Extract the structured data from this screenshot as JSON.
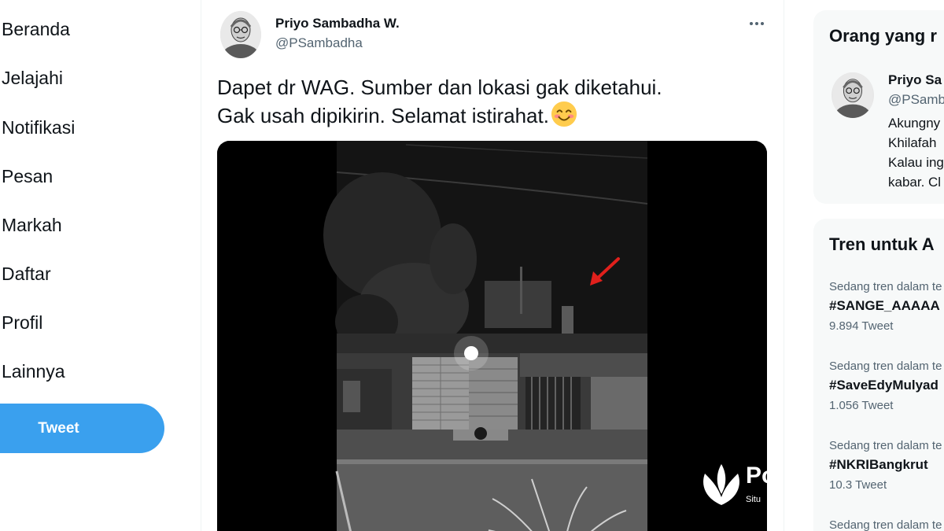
{
  "nav": {
    "items": [
      {
        "label": "Beranda"
      },
      {
        "label": "Jelajahi"
      },
      {
        "label": "Notifikasi"
      },
      {
        "label": "Pesan"
      },
      {
        "label": "Markah"
      },
      {
        "label": "Daftar"
      },
      {
        "label": "Profil"
      },
      {
        "label": "Lainnya"
      }
    ],
    "tweet_button": "Tweet"
  },
  "tweet": {
    "author_name": "Priyo Sambadha W.",
    "author_handle": "@PSambadha",
    "text_line1": "Dapet dr WAG. Sumber dan lokasi gak diketahui.",
    "text_line2": "Gak usah dipikirin. Selamat istirahat.",
    "more_icon": "more-horizontal-icon",
    "emoji": "smiling-face-with-smiling-eyes"
  },
  "who_to_follow": {
    "title": "Orang yang r",
    "name": "Priyo Sa",
    "handle": "@PSamb",
    "bio_lines": [
      "Akungny",
      "Khilafah",
      "Kalau ing",
      "kabar. Cl"
    ]
  },
  "trends": {
    "title": "Tren untuk A",
    "items": [
      {
        "meta": "Sedang tren dalam te",
        "tag": "#SANGE_AAAAA",
        "count": "9.894 Tweet"
      },
      {
        "meta": "Sedang tren dalam te",
        "tag": "#SaveEdyMulyad",
        "count": "1.056 Tweet"
      },
      {
        "meta": "Sedang tren dalam te",
        "tag": "#NKRIBangkrut",
        "count": "10.3 Tweet"
      },
      {
        "meta": "Sedang tren dalam te",
        "tag": "",
        "count": ""
      }
    ]
  },
  "watermark": {
    "text": "Po",
    "sub": "Situ"
  },
  "colors": {
    "accent": "#3aa0ee",
    "text": "#0f1419",
    "muted": "#536471",
    "card_bg": "#f7f9f9",
    "divider": "#eff3f4"
  }
}
